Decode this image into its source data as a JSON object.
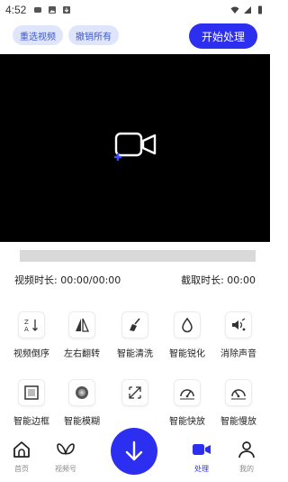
{
  "status_bar": {
    "time": "4:52",
    "icons": [
      "app-notification-icon",
      "image-notification-icon",
      "download-notification-icon",
      "wifi-icon",
      "signal-icon",
      "battery-icon"
    ]
  },
  "toolbar": {
    "reselect_label": "重选视频",
    "undo_all_label": "撤销所有",
    "start_label": "开始处理"
  },
  "player": {
    "icon": "add-video-icon"
  },
  "times": {
    "duration": "视频时长: 00:00/00:00",
    "clip": "截取时长: 00:00"
  },
  "tools": [
    {
      "label": "视频倒序",
      "icon": "reverse-sort-icon"
    },
    {
      "label": "左右翻转",
      "icon": "flip-horizontal-icon"
    },
    {
      "label": "智能清洗",
      "icon": "broom-icon"
    },
    {
      "label": "智能锐化",
      "icon": "drop-icon"
    },
    {
      "label": "消除声音",
      "icon": "mute-speaker-icon"
    },
    {
      "label": "智能边框",
      "icon": "frame-border-icon"
    },
    {
      "label": "智能模糊",
      "icon": "blur-lens-icon"
    },
    {
      "label": "",
      "icon": "expand-arrows-icon"
    },
    {
      "label": "智能快放",
      "icon": "speedometer-fast-icon"
    },
    {
      "label": "智能慢放",
      "icon": "speedometer-slow-icon"
    }
  ],
  "nav": {
    "home": "首页",
    "channels": "视频号",
    "process": "处理",
    "mine": "我的"
  },
  "colors": {
    "accent": "#2c2ff0",
    "pill_bg": "#dfe6fb",
    "pill_text": "#3e57cc"
  }
}
